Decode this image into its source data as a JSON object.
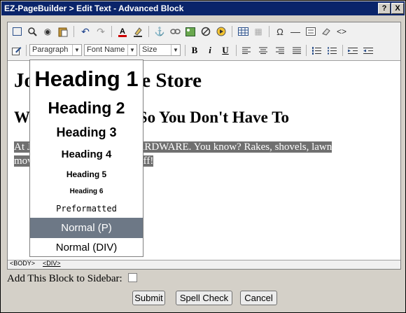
{
  "window": {
    "title": "EZ-PageBuilder > Edit Text - Advanced Block",
    "help_label": "?",
    "close_label": "X"
  },
  "toolbar": {
    "format_value": "Paragraph",
    "font_value": "Font Name",
    "size_value": "Size",
    "bold_label": "B",
    "italic_label": "i",
    "underline_label": "U"
  },
  "content": {
    "heading1": "Joe's Hardware Store",
    "heading2": "We Do Hardware So You Don't Have To",
    "paragraph_start": "At J",
    "paragraph_mid": "ll HARDWARE.  You know?  Rakes, shovels, lawn",
    "paragraph_line2a": "mov",
    "paragraph_line2b": "ly stuff!"
  },
  "format_dropdown": {
    "items": [
      "Heading 1",
      "Heading 2",
      "Heading 3",
      "Heading 4",
      "Heading 5",
      "Heading 6",
      "Preformatted",
      "Normal (P)",
      "Normal (DIV)"
    ],
    "selected": "Normal (P)"
  },
  "statusbar": {
    "body_tag": "<BODY>",
    "div_tag": "<DIV>"
  },
  "sidebar_label": "Add This Block to Sidebar:",
  "buttons": {
    "submit": "Submit",
    "spell_check": "Spell Check",
    "cancel": "Cancel"
  },
  "colors": {
    "titlebar": "#0a246a",
    "selection": "#707070",
    "dropdown_selected": "#6d7886"
  }
}
